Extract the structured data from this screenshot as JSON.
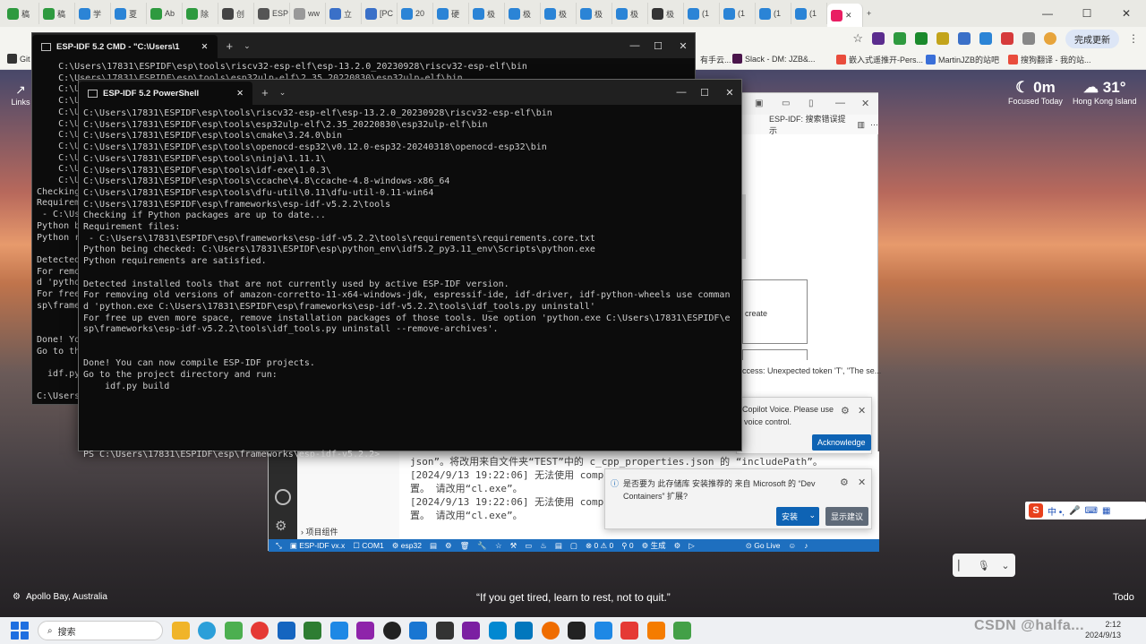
{
  "browser": {
    "tabs": [
      "稿",
      "稿",
      "学",
      "夏",
      "Ab",
      "除",
      "创",
      "ESP",
      "ww",
      "立",
      "[PC",
      "20",
      "硬",
      "极",
      "极",
      "极",
      "极",
      "极",
      "极",
      "(1",
      "(1",
      "(1",
      "(1"
    ],
    "update_label": "完成更新",
    "bookmarks": [
      "Git",
      "有手云...",
      "Slack - DM: JZB&...",
      "嵌入式遥推开-Pers...",
      "MartinJZB的站吧",
      "搜狗翻译 - 我的站..."
    ]
  },
  "desktop": {
    "links_label": "Links",
    "weather_left": {
      "value": "0m",
      "caption": "Focused Today"
    },
    "weather_right": {
      "value": "31°",
      "caption": "Hong Kong Island"
    },
    "location": "Apollo Bay, Australia",
    "quote": "“If you get tired, learn to rest, not to quit.”",
    "todo": "Todo",
    "ime_chars": "中 •,"
  },
  "cmd": {
    "title": "ESP-IDF 5.2 CMD - \"C:\\Users\\1",
    "lines": [
      "    C:\\Users\\17831\\ESPIDF\\esp\\tools\\riscv32-esp-elf\\esp-13.2.0_20230928\\riscv32-esp-elf\\bin",
      "    C:\\Users\\17831\\ESPIDF\\esp\\tools\\esp32ulp-elf\\2.35_20220830\\esp32ulp-elf\\bin",
      "    C:\\U",
      "    C:\\U",
      "    C:\\U",
      "    C:\\U",
      "    C:\\U",
      "    C:\\U",
      "    C:\\U",
      "    C:\\U",
      "    C:\\U",
      "Checking",
      "Requirem",
      " - C:\\Us",
      "Python b",
      "Python r",
      "",
      "Detected",
      "For remo",
      "d 'pytho",
      "For free",
      "sp\\frame",
      "",
      "",
      "Done! Yo",
      "Go to th",
      "",
      "  idf.py",
      "",
      "C:\\Users"
    ]
  },
  "ps": {
    "title": "ESP-IDF 5.2 PowerShell",
    "lines": [
      "C:\\Users\\17831\\ESPIDF\\esp\\tools\\riscv32-esp-elf\\esp-13.2.0_20230928\\riscv32-esp-elf\\bin",
      "C:\\Users\\17831\\ESPIDF\\esp\\tools\\esp32ulp-elf\\2.35_20220830\\esp32ulp-elf\\bin",
      "C:\\Users\\17831\\ESPIDF\\esp\\tools\\cmake\\3.24.0\\bin",
      "C:\\Users\\17831\\ESPIDF\\esp\\tools\\openocd-esp32\\v0.12.0-esp32-20240318\\openocd-esp32\\bin",
      "C:\\Users\\17831\\ESPIDF\\esp\\tools\\ninja\\1.11.1\\",
      "C:\\Users\\17831\\ESPIDF\\esp\\tools\\idf-exe\\1.0.3\\",
      "C:\\Users\\17831\\ESPIDF\\esp\\tools\\ccache\\4.8\\ccache-4.8-windows-x86_64",
      "C:\\Users\\17831\\ESPIDF\\esp\\tools\\dfu-util\\0.11\\dfu-util-0.11-win64",
      "C:\\Users\\17831\\ESPIDF\\esp\\frameworks\\esp-idf-v5.2.2\\tools",
      "Checking if Python packages are up to date...",
      "Requirement files:",
      " - C:\\Users\\17831\\ESPIDF\\esp\\frameworks\\esp-idf-v5.2.2\\tools\\requirements\\requirements.core.txt",
      "Python being checked: C:\\Users\\17831\\ESPIDF\\esp\\python_env\\idf5.2_py3.11_env\\Scripts\\python.exe",
      "Python requirements are satisfied.",
      "",
      "Detected installed tools that are not currently used by active ESP-IDF version.",
      "For removing old versions of amazon-corretto-11-x64-windows-jdk, espressif-ide, idf-driver, idf-python-wheels use comman",
      "d 'python.exe C:\\Users\\17831\\ESPIDF\\esp\\frameworks\\esp-idf-v5.2.2\\tools\\idf_tools.py uninstall'",
      "For free up even more space, remove installation packages of those tools. Use option 'python.exe C:\\Users\\17831\\ESPIDF\\e",
      "sp\\frameworks\\esp-idf-v5.2.2\\tools\\idf_tools.py uninstall --remove-archives'.",
      "",
      "",
      "Done! You can now compile ESP-IDF projects.",
      "Go to the project directory and run:",
      "    idf.py build",
      "",
      "",
      "",
      "",
      "",
      "PS C:\\Users\\17831\\ESPIDF\\esp\\frameworks\\esp-idf-v5.2.2>"
    ]
  },
  "vscode": {
    "cmd_label": "ESP-IDF: 搜索错误提示",
    "create_label": "create",
    "error_text": "ccess: Unexpected token 'T', \"The se...",
    "explorer_label": "项目组件",
    "output_lines": [
      "json”。将改用来自文件夹“TEST”中的 c_cpp_properties.json 的 “includePath”。",
      "[2024/9/13 19:22:06] 无法使用 compi",
      "置。 请改用“cl.exe”。",
      "[2024/9/13 19:22:06] 无法使用 compi",
      "置。 请改用“cl.exe”。"
    ],
    "status": {
      "idf": "ESP-IDF vx.x",
      "port": "COM1",
      "target": "esp32",
      "problems": "0 ⚠ 0",
      "warnings": "0",
      "build": "生成",
      "golive": "Go Live"
    }
  },
  "notifications": {
    "copilot": {
      "line1": "Copilot Voice. Please use",
      "line2": "voice control.",
      "button": "Acknowledge"
    },
    "devcontainers": {
      "line1": "是否要为 此存储库 安装推荐的 来自 Microsoft 的 “Dev",
      "line2": "Containers” 扩展?",
      "install": "安装",
      "show": "显示建议"
    }
  },
  "taskbar": {
    "search_placeholder": "搜索",
    "time": "2:12",
    "date": "2024/9/13"
  },
  "watermark": "CSDN @halfa..."
}
